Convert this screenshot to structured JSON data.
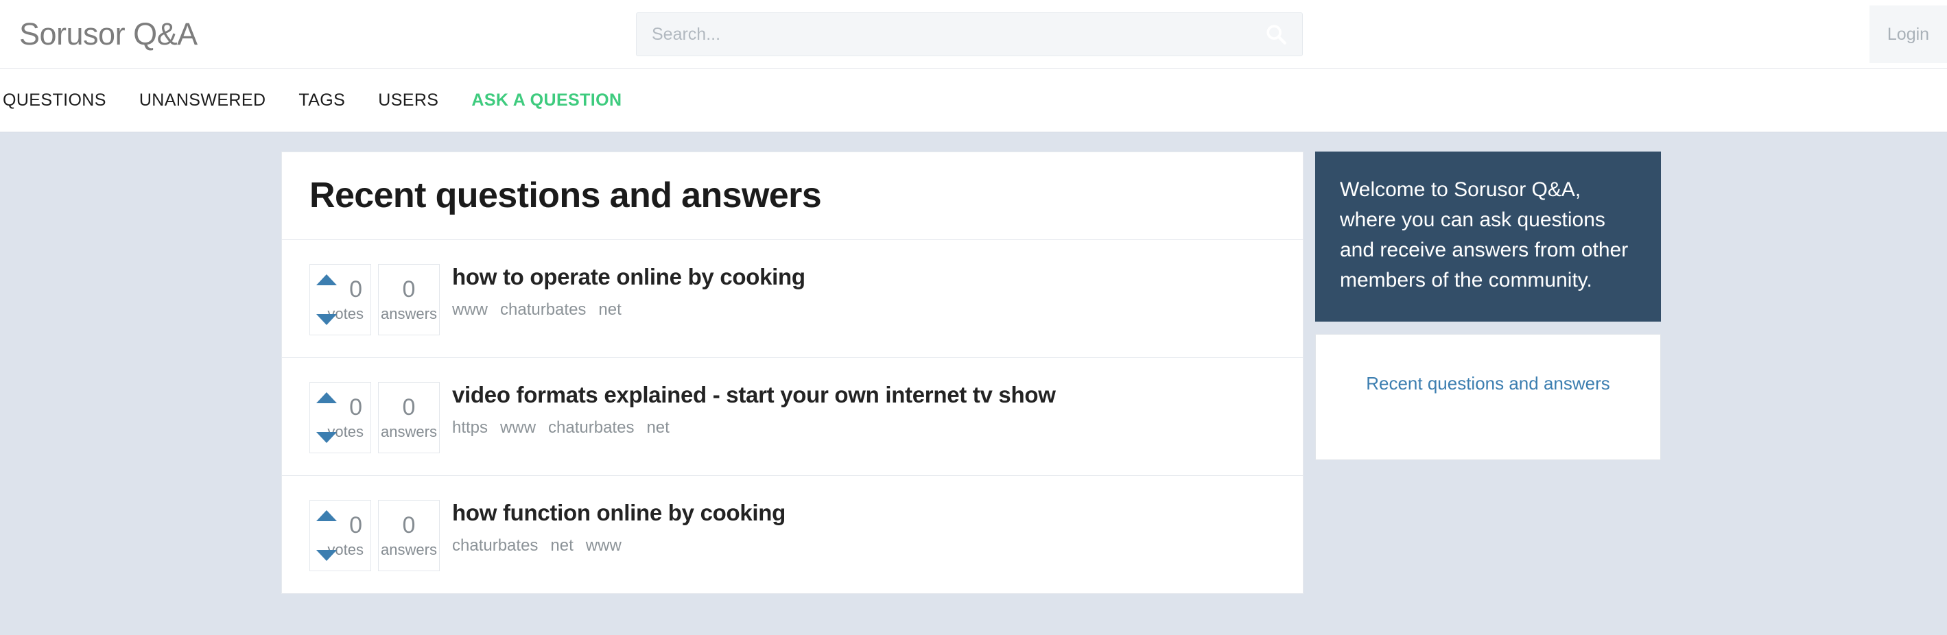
{
  "header": {
    "site_title": "Sorusor Q&A",
    "search": {
      "placeholder": "Search...",
      "value": "",
      "icon": "search-icon"
    },
    "login_label": "Login"
  },
  "nav": {
    "items": [
      {
        "label": "QUESTIONS",
        "accent": false
      },
      {
        "label": "UNANSWERED",
        "accent": false
      },
      {
        "label": "TAGS",
        "accent": false
      },
      {
        "label": "USERS",
        "accent": false
      },
      {
        "label": "ASK A QUESTION",
        "accent": true
      }
    ],
    "accent_color": "#3ecb7e"
  },
  "main": {
    "title": "Recent questions and answers",
    "questions": [
      {
        "votes": "0",
        "votes_label": "votes",
        "answers": "0",
        "answers_label": "answers",
        "title": "how to operate online by cooking",
        "tags": [
          "www",
          "chaturbates",
          "net"
        ]
      },
      {
        "votes": "0",
        "votes_label": "votes",
        "answers": "0",
        "answers_label": "answers",
        "title": "video formats explained - start your own internet tv show",
        "tags": [
          "https",
          "www",
          "chaturbates",
          "net"
        ]
      },
      {
        "votes": "0",
        "votes_label": "votes",
        "answers": "0",
        "answers_label": "answers",
        "title": "how function online by cooking",
        "tags": [
          "chaturbates",
          "net",
          "www"
        ]
      }
    ]
  },
  "sidebar": {
    "welcome_text": "Welcome to Sorusor Q&A, where you can ask questions and receive answers from other members of the community.",
    "welcome_bg": "#334e68",
    "links": [
      {
        "label": "Recent questions and answers"
      }
    ],
    "link_color": "#3c7eb0"
  },
  "colors": {
    "page_background": "#dde3ec",
    "vote_arrow": "#3c7eb0",
    "panel_background": "#ffffff"
  }
}
